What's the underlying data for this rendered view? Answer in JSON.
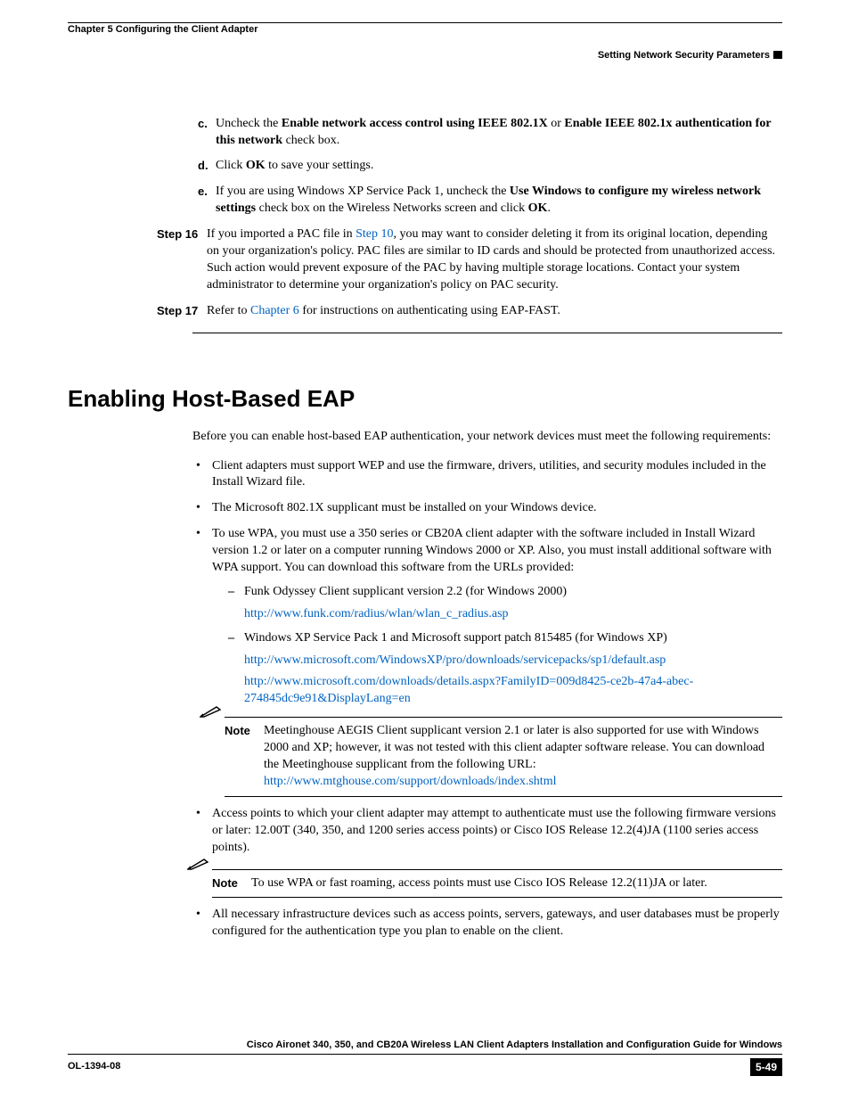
{
  "header": {
    "chapter": "Chapter 5      Configuring the Client Adapter",
    "section": "Setting Network Security Parameters"
  },
  "steps": {
    "c": {
      "label": "c.",
      "t1": "Uncheck the ",
      "b1": "Enable network access control using IEEE 802.1X",
      "t2": " or ",
      "b2": "Enable IEEE 802.1x authentication for this network",
      "t3": " check box."
    },
    "d": {
      "label": "d.",
      "t1": "Click ",
      "b1": "OK",
      "t2": " to save your settings."
    },
    "e": {
      "label": "e.",
      "t1": "If you are using Windows XP Service Pack 1, uncheck the ",
      "b1": "Use Windows to configure my wireless network settings",
      "t2": " check box on the Wireless Networks screen and click ",
      "b2": "OK",
      "t3": "."
    },
    "s16": {
      "label": "Step 16",
      "t1": "If you imported a PAC file in ",
      "l1": "Step 10",
      "t2": ", you may want to consider deleting it from its original location, depending on your organization's policy. PAC files are similar to ID cards and should be protected from unauthorized access. Such action would prevent exposure of the PAC by having multiple storage locations. Contact your system administrator to determine your organization's policy on PAC security."
    },
    "s17": {
      "label": "Step 17",
      "t1": "Refer to ",
      "l1": "Chapter 6",
      "t2": " for instructions on authenticating using EAP-FAST."
    }
  },
  "sectionTitle": "Enabling Host-Based EAP",
  "intro": "Before you can enable host-based EAP authentication, your network devices must meet the following requirements:",
  "bullets": {
    "b1": "Client adapters must support WEP and use the firmware, drivers, utilities, and security modules included in the Install Wizard file.",
    "b2": "The Microsoft 802.1X supplicant must be installed on your Windows device.",
    "b3": "To use WPA, you must use a 350 series or CB20A client adapter with the software included in Install Wizard version 1.2 or later on a computer running Windows 2000 or XP. Also, you must install additional software with WPA support. You can download this software from the URLs provided:",
    "sub1": "Funk Odyssey Client supplicant version 2.2 (for Windows 2000)",
    "sub1link": "http://www.funk.com/radius/wlan/wlan_c_radius.asp",
    "sub2": "Windows XP Service Pack 1 and Microsoft support patch 815485 (for Windows XP)",
    "sub2link1": "http://www.microsoft.com/WindowsXP/pro/downloads/servicepacks/sp1/default.asp",
    "sub2link2": "http://www.microsoft.com/downloads/details.aspx?FamilyID=009d8425-ce2b-47a4-abec-274845dc9e91&DisplayLang=en",
    "b4": "Access points to which your client adapter may attempt to authenticate must use the following firmware versions or later: 12.00T (340, 350, and 1200 series access points) or Cisco IOS Release 12.2(4)JA (1100 series access points).",
    "b5": "All necessary infrastructure devices such as access points, servers, gateways, and user databases must be properly configured for the authentication type you plan to enable on the client."
  },
  "notes": {
    "label": "Note",
    "n1a": "Meetinghouse AEGIS Client supplicant version 2.1 or later is also supported for use with Windows 2000 and XP; however, it was not tested with this client adapter software release. You can download the Meetinghouse supplicant from the following URL: ",
    "n1link": "http://www.mtghouse.com/support/downloads/index.shtml",
    "n2": "To use WPA or fast roaming, access points must use Cisco IOS Release 12.2(11)JA or later."
  },
  "footer": {
    "title": "Cisco Aironet 340, 350, and CB20A Wireless LAN Client Adapters Installation and Configuration Guide for Windows",
    "docnum": "OL-1394-08",
    "pageA": "5-49"
  }
}
